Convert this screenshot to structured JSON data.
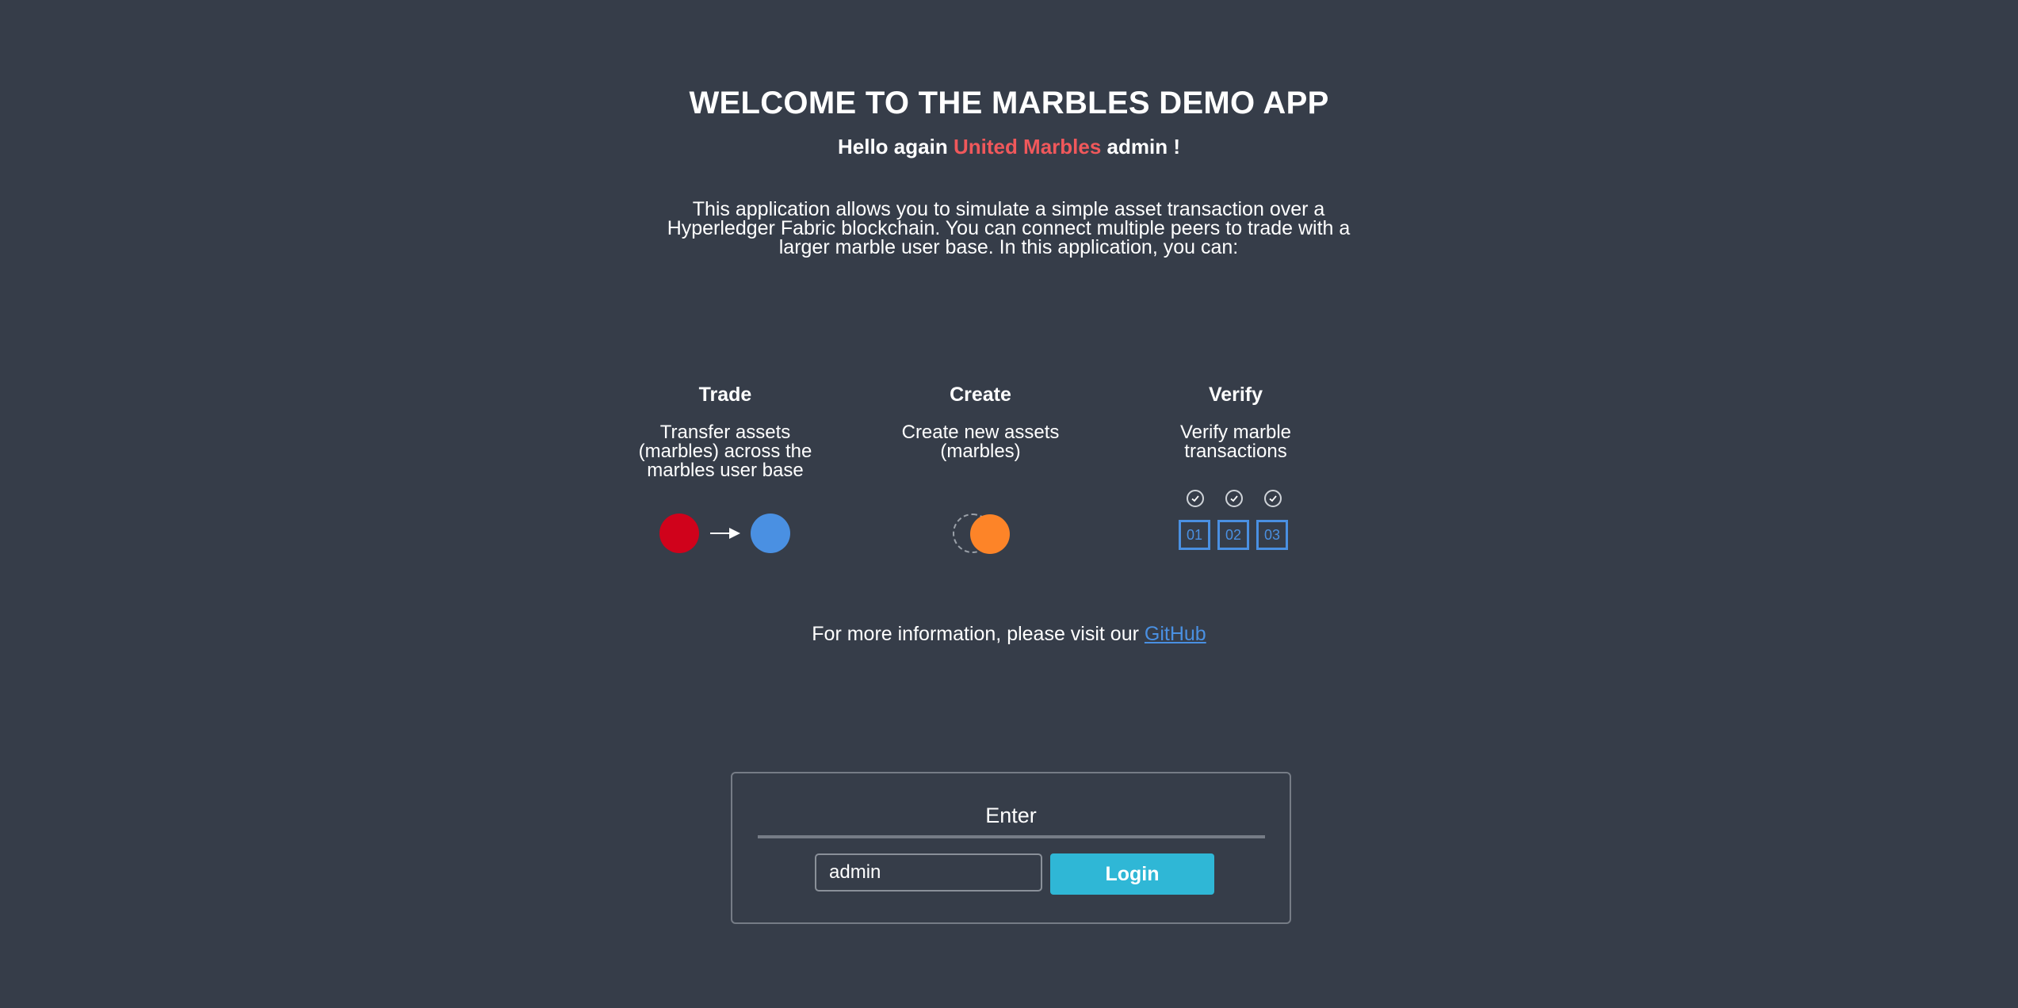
{
  "header": {
    "title": "WELCOME TO THE MARBLES DEMO APP",
    "greeting_prefix": "Hello again",
    "company": "United Marbles",
    "greeting_suffix": "admin !",
    "company_color": "#f0585b"
  },
  "intro": {
    "text": "This application allows you to simulate a simple asset transaction over a Hyperledger Fabric blockchain. You can connect multiple peers to trade with a larger marble user base. In this application, you can:"
  },
  "features": [
    {
      "title": "Trade",
      "description": "Transfer assets (marbles) across the marbles user base",
      "graphic": {
        "from_color": "#d0021b",
        "to_color": "#4a90e2",
        "icon": "arrow-right-icon"
      }
    },
    {
      "title": "Create",
      "description": "Create new assets (marbles)",
      "graphic": {
        "color": "#fd8428",
        "icon": "new-marble-icon"
      }
    },
    {
      "title": "Verify",
      "description": "Verify marble transactions",
      "graphic": {
        "blocks": [
          "01",
          "02",
          "03"
        ],
        "icon": "check-circle-icon",
        "color": "#4a90e2"
      }
    }
  ],
  "footer": {
    "more_info_text": "For more information, please visit our",
    "link_text": "GitHub",
    "link_color": "#4a90e2"
  },
  "login": {
    "title": "Enter",
    "username_value": "admin",
    "button_label": "Login",
    "button_color": "#2fb7d6"
  },
  "colors": {
    "background": "#363d49",
    "text": "#ffffff"
  }
}
